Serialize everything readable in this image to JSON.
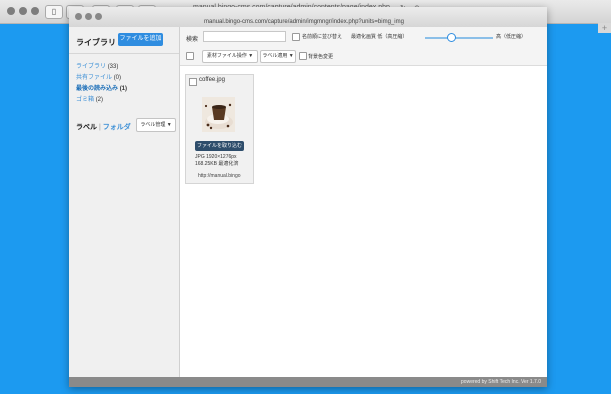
{
  "browser": {
    "back_label": "<",
    "new_tab_label": "+"
  },
  "window": {
    "url_outer": "manual.bingo-cms.com/capture/admin/contents/page/index.php",
    "url_inner": "manual.bingo-cms.com/capture/admin/imgmngr/index.php?units=bimg_img"
  },
  "sidebar": {
    "title": "ライブラリ",
    "add_button": "ファイルを追加",
    "items": [
      {
        "label": "ライブラリ",
        "count": "(33)"
      },
      {
        "label": "共有ファイル",
        "count": "(0)"
      },
      {
        "label": "最後の読み込み",
        "count": "(1)"
      },
      {
        "label": "ゴミ箱",
        "count": "(2)"
      }
    ],
    "label_tab": "ラベル",
    "separator": "|",
    "folder_tab": "フォルダ",
    "manage_button": "ラベル管理 ▼"
  },
  "toolbar": {
    "search_label": "検索",
    "search_value": "",
    "sort_label": "名前順に並び替え",
    "slider_label_left": "最適化画質 低（高圧縮）",
    "slider_label_right": "高（低圧縮）",
    "slider_value": 0.35,
    "action_dropdown": "素材ファイル操作 ▼",
    "label_apply_dropdown": "ラベル適用 ▼",
    "bg_change_label": "背景色変更"
  },
  "file_card": {
    "name": "coffee.jpg",
    "import_button": "ファイルを取り込む",
    "info_line1": "JPG 1920×1276px",
    "info_line2": "168.25KB 最適化済",
    "url": "http://manual.bingo"
  },
  "footer": {
    "text": "powered by Shift Tech Inc. Ver 1.7.0"
  },
  "colors": {
    "desktop": "#1c9af0",
    "accent": "#2f8de0",
    "import_button": "#2e4d6b"
  }
}
